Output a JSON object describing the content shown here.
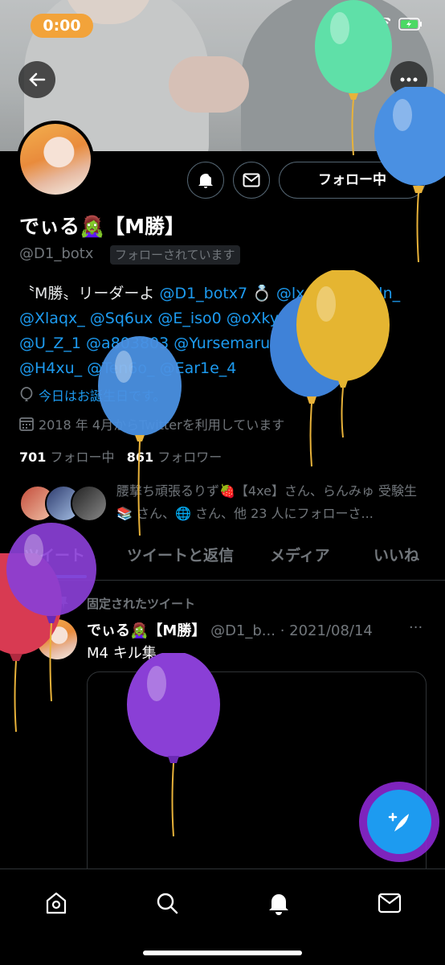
{
  "status_bar": {
    "timer": "0:00"
  },
  "profile": {
    "follow_button_label": "フォロー中",
    "name": "でぃる🧟‍♀️【M勝】",
    "handle": "@D1_botx",
    "follows_you": "フォローされています",
    "bio": {
      "l1_text": "〝M勝〟リーダーよ ",
      "l1_mentions": "@D1_botx7 💍 @lxery_ @suiln_",
      "l2": "@Xlaqx_ @Sq6ux @E_iso0 @oXkyo_ @_Neoy",
      "l3": "@U_Z_1 @a803803 @Yursemaru @_Sawy_",
      "l4": "@H4xu_ @Ten6o_ @Ear1e_4"
    },
    "birthday": "今日はお誕生日です。",
    "joined": "2018 年 4月からTwitterを利用しています",
    "following_count": "701",
    "following_label": "フォロー中",
    "followers_count": "861",
    "followers_label": "フォロワー",
    "followed_by_text": "腰撃ち頑張るりず🍓【4xe】さん、らんみゅ 受験生📚 さん、🌐 さん、他 23 人にフォローさ..."
  },
  "tabs": [
    {
      "label": "ツイート"
    },
    {
      "label": "ツイートと返信"
    },
    {
      "label": "メディア"
    },
    {
      "label": "いいね"
    }
  ],
  "tweet": {
    "pinned_label": "固定されたツイート",
    "author": "でぃる🧟‍♀️【M勝】",
    "handle_date": "@D1_b... · 2021/08/14",
    "more": "···",
    "text": "M4 キル集"
  },
  "colors": {
    "accent": "#1d9bf0",
    "background": "#000000",
    "timer": "#f2a33a",
    "muted": "#71767b"
  },
  "icons": [
    "back-icon",
    "more-icon",
    "bell-icon",
    "mail-icon",
    "birthday-icon",
    "calendar-icon",
    "pin-icon",
    "compose-icon",
    "home-icon",
    "search-icon",
    "notifications-icon",
    "messages-icon"
  ]
}
